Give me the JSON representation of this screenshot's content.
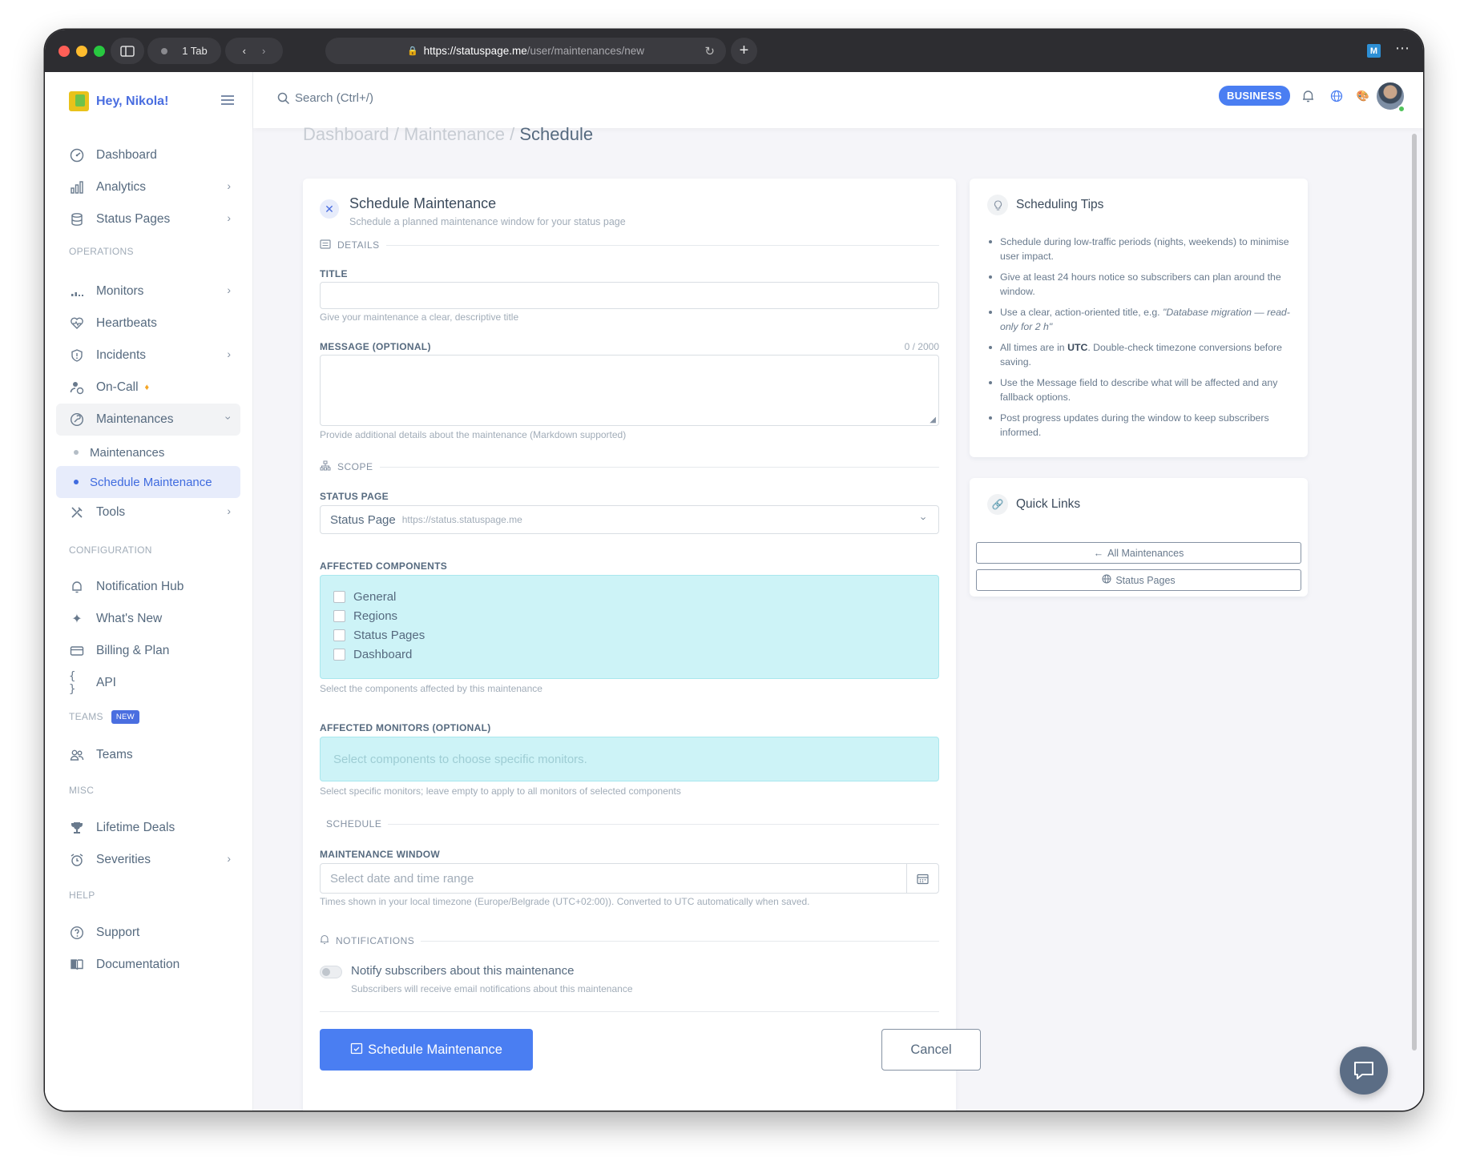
{
  "browser": {
    "tab_count": "1 Tab",
    "url_host": "https://statuspage.me",
    "url_path": "/user/maintenances/new"
  },
  "sidebar": {
    "greeting": "Hey, Nikola!",
    "items_top": [
      {
        "label": "Dashboard",
        "icon": "dashboard-icon"
      },
      {
        "label": "Analytics",
        "icon": "analytics-icon"
      },
      {
        "label": "Status Pages",
        "icon": "status-pages-icon"
      }
    ],
    "section_operations": "OPERATIONS",
    "items_ops": [
      {
        "label": "Monitors"
      },
      {
        "label": "Heartbeats"
      },
      {
        "label": "Incidents"
      },
      {
        "label": "On-Call"
      },
      {
        "label": "Maintenances"
      }
    ],
    "sub_items": [
      {
        "label": "Maintenances"
      },
      {
        "label": "Schedule Maintenance"
      }
    ],
    "tools": "Tools",
    "section_configuration": "CONFIGURATION",
    "items_config": [
      {
        "label": "Notification Hub"
      },
      {
        "label": "What's New"
      },
      {
        "label": "Billing & Plan"
      },
      {
        "label": "API"
      }
    ],
    "section_teams": "TEAMS",
    "teams_badge": "NEW",
    "teams": "Teams",
    "section_misc": "MISC",
    "items_misc": [
      {
        "label": "Lifetime Deals"
      },
      {
        "label": "Severities"
      }
    ],
    "section_help": "HELP",
    "items_help": [
      {
        "label": "Support"
      },
      {
        "label": "Documentation"
      }
    ]
  },
  "topbar": {
    "search_placeholder": "Search (Ctrl+/)",
    "plan_badge": "BUSINESS"
  },
  "breadcrumb": {
    "part1": "Dashboard",
    "sep": "/",
    "part2": "Maintenance",
    "current": "Schedule"
  },
  "form": {
    "title": "Schedule Maintenance",
    "subtitle": "Schedule a planned maintenance window for your status page",
    "section_details": "DETAILS",
    "title_label": "TITLE",
    "title_value": "",
    "title_help": "Give your maintenance a clear, descriptive title",
    "message_label": "MESSAGE (OPTIONAL)",
    "message_counter": "0 / 2000",
    "message_help": "Provide additional details about the maintenance (Markdown supported)",
    "section_scope": "SCOPE",
    "status_page_label": "STATUS PAGE",
    "status_page_value": "Status Page",
    "status_page_url": "https://status.statuspage.me",
    "components_label": "AFFECTED COMPONENTS",
    "components": [
      {
        "label": "General",
        "checked": false
      },
      {
        "label": "Regions",
        "checked": false
      },
      {
        "label": "Status Pages",
        "checked": false
      },
      {
        "label": "Dashboard",
        "checked": false
      }
    ],
    "components_help": "Select the components affected by this maintenance",
    "monitors_label": "AFFECTED MONITORS (OPTIONAL)",
    "monitors_placeholder": "Select components to choose specific monitors.",
    "monitors_help": "Select specific monitors; leave empty to apply to all monitors of selected components",
    "section_schedule": "SCHEDULE",
    "window_label": "MAINTENANCE WINDOW",
    "window_placeholder": "Select date and time range",
    "window_help": "Times shown in your local timezone (Europe/Belgrade (UTC+02:00)). Converted to UTC automatically when saved.",
    "section_notifications": "NOTIFICATIONS",
    "notify_label": "Notify subscribers about this maintenance",
    "notify_help": "Subscribers will receive email notifications about this maintenance",
    "notify_enabled": false,
    "submit_label": "Schedule Maintenance",
    "cancel_label": "Cancel"
  },
  "tips": {
    "title": "Scheduling Tips",
    "items": [
      "Schedule during low-traffic periods (nights, weekends) to minimise user impact.",
      "Give at least 24 hours notice so subscribers can plan around the window.",
      "Use a clear, action-oriented title, e.g.",
      "All times are in",
      "Use the Message field to describe what will be affected and any fallback options.",
      "Post progress updates during the window to keep subscribers informed."
    ],
    "example_title": "\"Database migration — read-only for 2 h\"",
    "utc": "UTC",
    "utc_suffix": ". Double-check timezone conversions before saving."
  },
  "quick_links": {
    "title": "Quick Links",
    "all_maintenances": "All Maintenances",
    "status_pages": "Status Pages"
  },
  "colors": {
    "primary": "#4a7ef2",
    "highlight_box": "#cdf3f7"
  }
}
